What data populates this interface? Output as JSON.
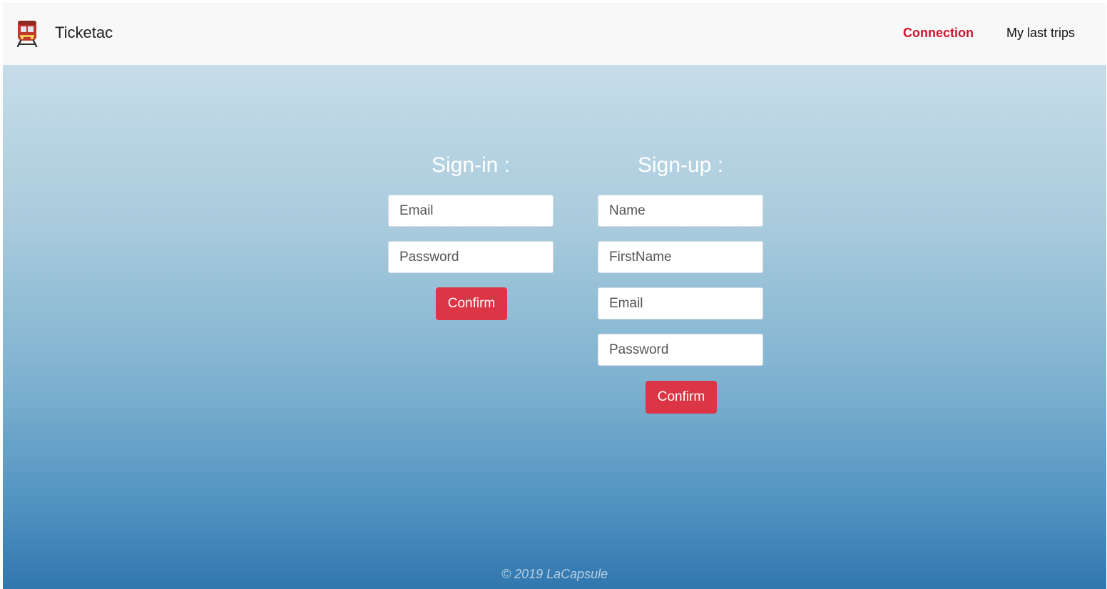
{
  "navbar": {
    "brand_name": "Ticketac",
    "brand_icon": "train-icon",
    "links": [
      {
        "label": "Connection",
        "active": true
      },
      {
        "label": "My last trips",
        "active": false
      }
    ],
    "active_color": "#d0142c"
  },
  "signin": {
    "title": "Sign-in :",
    "email_placeholder": "Email",
    "password_placeholder": "Password",
    "confirm_label": "Confirm"
  },
  "signup": {
    "title": "Sign-up :",
    "name_placeholder": "Name",
    "firstname_placeholder": "FirstName",
    "email_placeholder": "Email",
    "password_placeholder": "Password",
    "confirm_label": "Confirm"
  },
  "footer": {
    "copyright": "© 2019 LaCapsule"
  },
  "colors": {
    "button": "#dc3545",
    "background_top": "#c6dde8",
    "background_bottom": "#3077ae"
  }
}
